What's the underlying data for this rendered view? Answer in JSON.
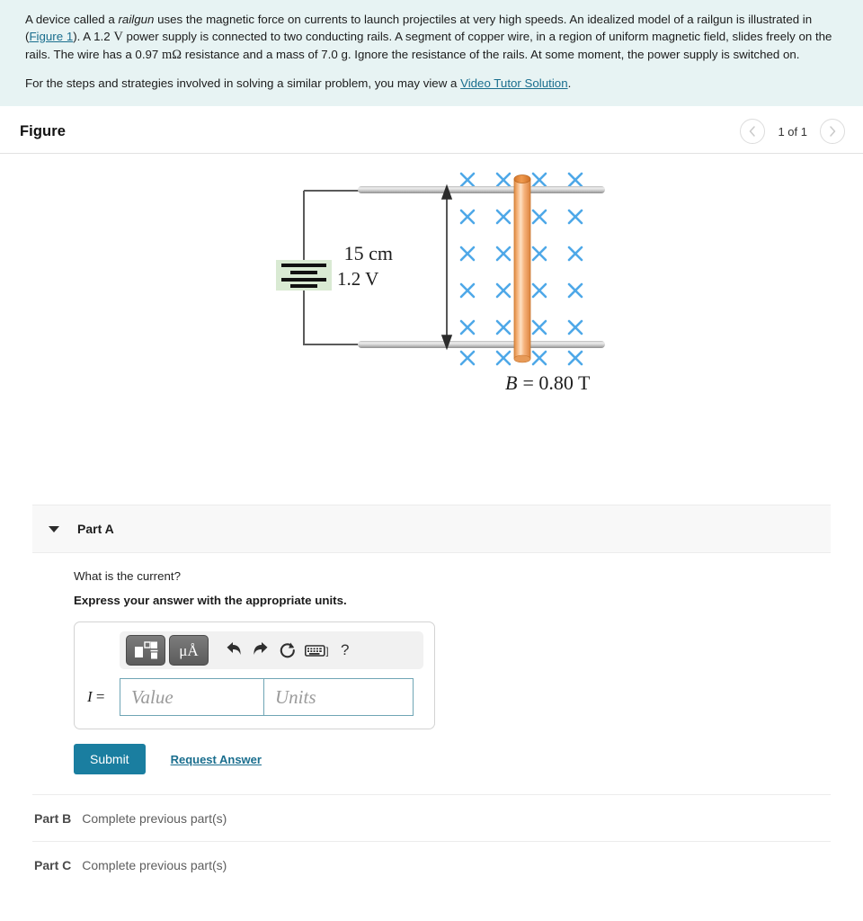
{
  "statement": {
    "para1_a": "A device called a ",
    "para1_em": "railgun",
    "para1_b": " uses the magnetic force on currents to launch projectiles at very high speeds. An idealized model of a railgun is illustrated in (",
    "figure_link": "Figure 1",
    "para1_c": "). A 1.2 ",
    "volt_unit": "V",
    "para1_d": " power supply is connected to two conducting rails. A segment of copper wire, in a region of uniform magnetic field, slides freely on the rails. The wire has a 0.97 ",
    "ohm_unit": "mΩ",
    "para1_e": " resistance and a mass of 7.0 g. Ignore the resistance of the rails. At some moment, the power supply is switched on.",
    "para2_a": "For the steps and strategies involved in solving a similar problem, you may view a ",
    "video_link": "Video Tutor Solution",
    "para2_b": "."
  },
  "figure": {
    "title": "Figure",
    "pager_label": "1 of 1",
    "prev_icon": "chevron-left-icon",
    "next_icon": "chevron-right-icon",
    "battery_label": "1.2 V",
    "length_label": "15 cm",
    "field_label": "B = 0.80 T",
    "field_symbol": "B",
    "field_value": "= 0.80 T",
    "field_marker": "×",
    "colors": {
      "field_marker": "#4ea8e8",
      "wire_light": "#fbd7b4",
      "wire_mid": "#f0a868",
      "wire_dark": "#d9823c",
      "rail_light": "#e9e9e9",
      "rail_dark": "#9a9a9a",
      "battery_highlight": "#d9ead3",
      "circuit_line": "#595959"
    }
  },
  "part_a": {
    "caret_icon": "caret-down-icon",
    "label": "Part A",
    "question": "What is the current?",
    "instruction": "Express your answer with the appropriate units.",
    "toolbar": {
      "template_button": "template-icon",
      "units_button": "μÅ",
      "undo_icon": "undo-icon",
      "redo_icon": "redo-icon",
      "reset_icon": "reset-icon",
      "keyboard_icon": "keyboard-icon",
      "keyboard_bracket": "]",
      "help_label": "?"
    },
    "variable": "I",
    "equals": "=",
    "value_placeholder": "Value",
    "units_placeholder": "Units",
    "value_current": "",
    "units_current": "",
    "submit_label": "Submit",
    "request_answer_label": "Request Answer"
  },
  "other_parts": [
    {
      "label": "Part B",
      "status": "Complete previous part(s)"
    },
    {
      "label": "Part C",
      "status": "Complete previous part(s)"
    }
  ],
  "accent_color": "#1a7ea0"
}
